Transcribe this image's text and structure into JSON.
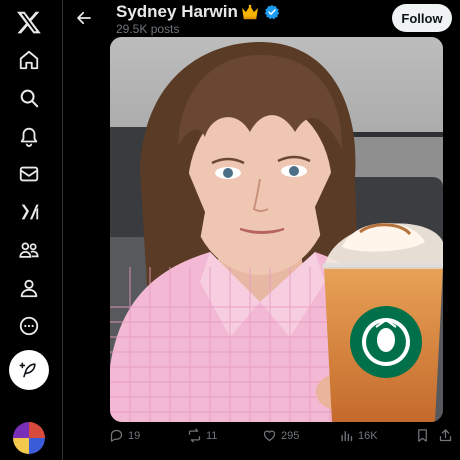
{
  "nav": {
    "items": [
      {
        "name": "x-logo-icon"
      },
      {
        "name": "home-icon"
      },
      {
        "name": "search-icon"
      },
      {
        "name": "bell-icon"
      },
      {
        "name": "mail-icon"
      },
      {
        "name": "grok-icon"
      },
      {
        "name": "communities-icon"
      },
      {
        "name": "profile-icon"
      },
      {
        "name": "more-icon"
      }
    ],
    "post_icon": "feather-plus-icon"
  },
  "header": {
    "name": "Sydney Harwin",
    "badge_emoji": "crown",
    "verified": true,
    "posts_count": "29.5K posts",
    "follow_label": "Follow"
  },
  "photo": {
    "description_icon": "selfie-photo"
  },
  "actions": {
    "replies": "19",
    "reposts": "11",
    "likes": "295",
    "views": "16K"
  },
  "colors": {
    "background": "#000000",
    "text": "#e7e9ea",
    "muted": "#71767b",
    "verified": "#1d9bf0",
    "follow_bg": "#eff3f4"
  }
}
